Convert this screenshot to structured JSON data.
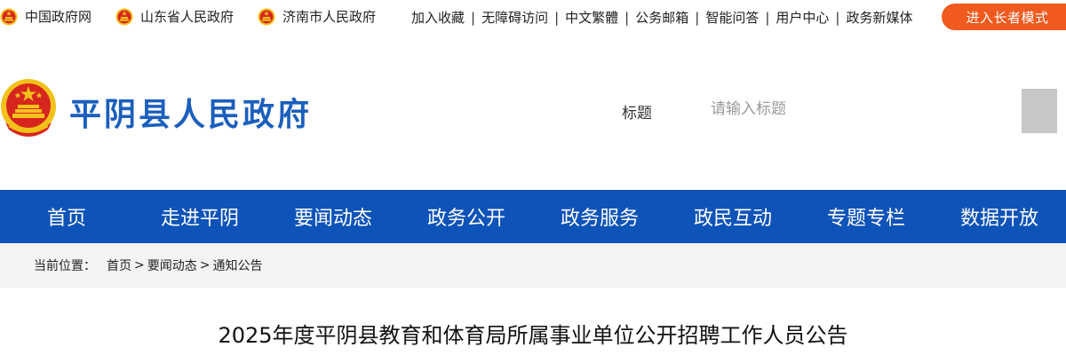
{
  "topbar": {
    "links": [
      "中国政府网",
      "山东省人民政府",
      "济南市人民政府"
    ],
    "tools": [
      "加入收藏",
      "无障碍访问",
      "中文繁體",
      "公务邮箱",
      "智能问答",
      "用户中心",
      "政务新媒体"
    ],
    "elder_mode": "进入长者模式"
  },
  "header": {
    "site_title": "平阴县人民政府",
    "search_label": "标题",
    "search_placeholder": "请输入标题"
  },
  "nav": [
    "首页",
    "走进平阴",
    "要闻动态",
    "政务公开",
    "政务服务",
    "政民互动",
    "专题专栏",
    "数据开放"
  ],
  "breadcrumb": {
    "prefix": "当前位置：",
    "items": [
      "首页",
      "要闻动态",
      "通知公告"
    ],
    "separator": ">"
  },
  "article": {
    "title": "2025年度平阴县教育和体育局所属事业单位公开招聘工作人员公告"
  },
  "colors": {
    "brand_blue": "#1b5fbd",
    "nav_blue": "#0e53b8",
    "elder_orange": "#f15a1e",
    "emblem_red": "#d7261e",
    "emblem_gold": "#f2c21b"
  }
}
